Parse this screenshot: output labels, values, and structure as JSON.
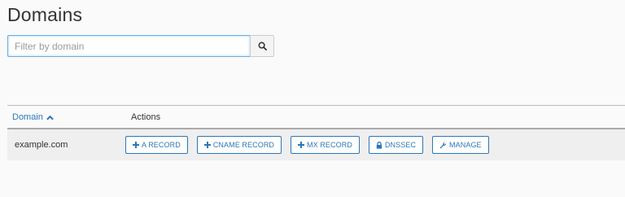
{
  "header": {
    "title": "Domains"
  },
  "search": {
    "placeholder": "Filter by domain",
    "value": "",
    "button_icon": "search-icon"
  },
  "table": {
    "columns": [
      {
        "label": "Domain",
        "sort": "ascending",
        "sort_icon": "chevron-up-icon"
      },
      {
        "label": "Actions"
      }
    ],
    "rows": [
      {
        "domain": "example.com",
        "actions": [
          {
            "label": "A RECORD",
            "icon": "plus-icon"
          },
          {
            "label": "CNAME RECORD",
            "icon": "plus-icon"
          },
          {
            "label": "MX RECORD",
            "icon": "plus-icon"
          },
          {
            "label": "DNSSEC",
            "icon": "lock-icon"
          },
          {
            "label": "MANAGE",
            "icon": "wrench-icon"
          }
        ]
      }
    ]
  },
  "colors": {
    "accent": "#2a78bb",
    "row_bg": "#efefef",
    "page_bg": "#fafafa"
  }
}
